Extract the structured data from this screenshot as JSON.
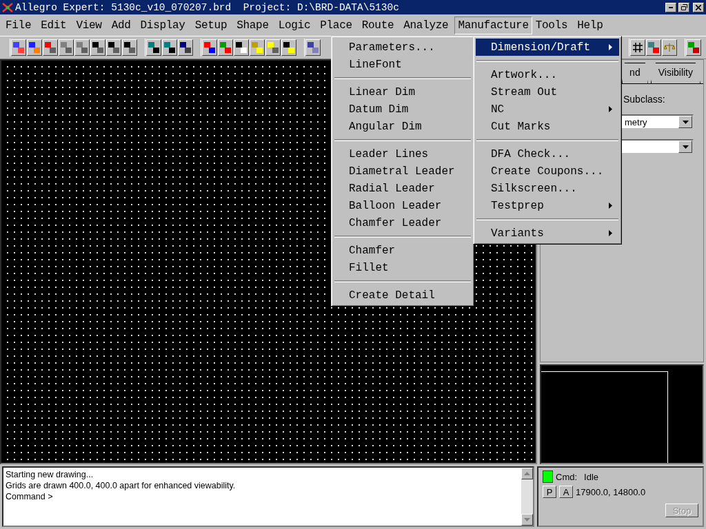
{
  "window": {
    "title": "Allegro Expert: 5130c_v10_070207.brd  Project: D:\\BRD-DATA\\5130c"
  },
  "menu_bar": [
    {
      "label": "File",
      "selected": false
    },
    {
      "label": "Edit",
      "selected": false
    },
    {
      "label": "View",
      "selected": false
    },
    {
      "label": "Add",
      "selected": false
    },
    {
      "label": "Display",
      "selected": false
    },
    {
      "label": "Setup",
      "selected": false
    },
    {
      "label": "Shape",
      "selected": false
    },
    {
      "label": "Logic",
      "selected": false
    },
    {
      "label": "Place",
      "selected": false
    },
    {
      "label": "Route",
      "selected": false
    },
    {
      "label": "Analyze",
      "selected": false
    },
    {
      "label": "Manufacture",
      "selected": true
    },
    {
      "label": "Tools",
      "selected": false
    },
    {
      "label": "Help",
      "selected": false
    }
  ],
  "manufacture_menu": [
    {
      "kind": "item",
      "label": "Dimension/Draft",
      "selected": true,
      "submenu": true
    },
    {
      "kind": "separator"
    },
    {
      "kind": "item",
      "label": "Artwork...",
      "selected": false,
      "submenu": false
    },
    {
      "kind": "item",
      "label": "Stream Out",
      "selected": false,
      "submenu": false
    },
    {
      "kind": "item",
      "label": "NC",
      "selected": false,
      "submenu": true
    },
    {
      "kind": "item",
      "label": "Cut Marks",
      "selected": false,
      "submenu": false
    },
    {
      "kind": "separator"
    },
    {
      "kind": "item",
      "label": "DFA Check...",
      "selected": false,
      "submenu": false
    },
    {
      "kind": "item",
      "label": "Create Coupons...",
      "selected": false,
      "submenu": false
    },
    {
      "kind": "item",
      "label": "Silkscreen...",
      "selected": false,
      "submenu": false
    },
    {
      "kind": "item",
      "label": "Testprep",
      "selected": false,
      "submenu": true
    },
    {
      "kind": "separator"
    },
    {
      "kind": "item",
      "label": "Variants",
      "selected": false,
      "submenu": true
    }
  ],
  "dimension_submenu": [
    {
      "kind": "item",
      "label": "Parameters...",
      "selected": false,
      "submenu": false
    },
    {
      "kind": "item",
      "label": "LineFont",
      "selected": false,
      "submenu": false
    },
    {
      "kind": "separator"
    },
    {
      "kind": "item",
      "label": "Linear Dim",
      "selected": false,
      "submenu": false
    },
    {
      "kind": "item",
      "label": "Datum Dim",
      "selected": false,
      "submenu": false
    },
    {
      "kind": "item",
      "label": "Angular Dim",
      "selected": false,
      "submenu": false
    },
    {
      "kind": "separator"
    },
    {
      "kind": "item",
      "label": "Leader Lines",
      "selected": false,
      "submenu": false
    },
    {
      "kind": "item",
      "label": "Diametral Leader",
      "selected": false,
      "submenu": false
    },
    {
      "kind": "item",
      "label": "Radial Leader",
      "selected": false,
      "submenu": false
    },
    {
      "kind": "item",
      "label": "Balloon Leader",
      "selected": false,
      "submenu": false
    },
    {
      "kind": "item",
      "label": "Chamfer Leader",
      "selected": false,
      "submenu": false
    },
    {
      "kind": "separator"
    },
    {
      "kind": "item",
      "label": "Chamfer",
      "selected": false,
      "submenu": false
    },
    {
      "kind": "item",
      "label": "Fillet",
      "selected": false,
      "submenu": false
    },
    {
      "kind": "separator"
    },
    {
      "kind": "item",
      "label": "Create Detail",
      "selected": false,
      "submenu": false
    }
  ],
  "side_panel": {
    "tabs": [
      {
        "label": "nd",
        "selected": false
      },
      {
        "label": "Visibility",
        "selected": false
      }
    ],
    "subclass_label": "Subclass:",
    "class_value": "metry"
  },
  "command_log": [
    "Starting new drawing...",
    "Grids are drawn 400.0, 400.0 apart for enhanced viewability.",
    "Command >"
  ],
  "status": {
    "label": "Cmd:",
    "value": "Idle",
    "buttons": [
      "P",
      "A"
    ],
    "coordinates": "17900.0, 14800.0",
    "stop": {
      "label": "Stop",
      "disabled": true
    }
  }
}
